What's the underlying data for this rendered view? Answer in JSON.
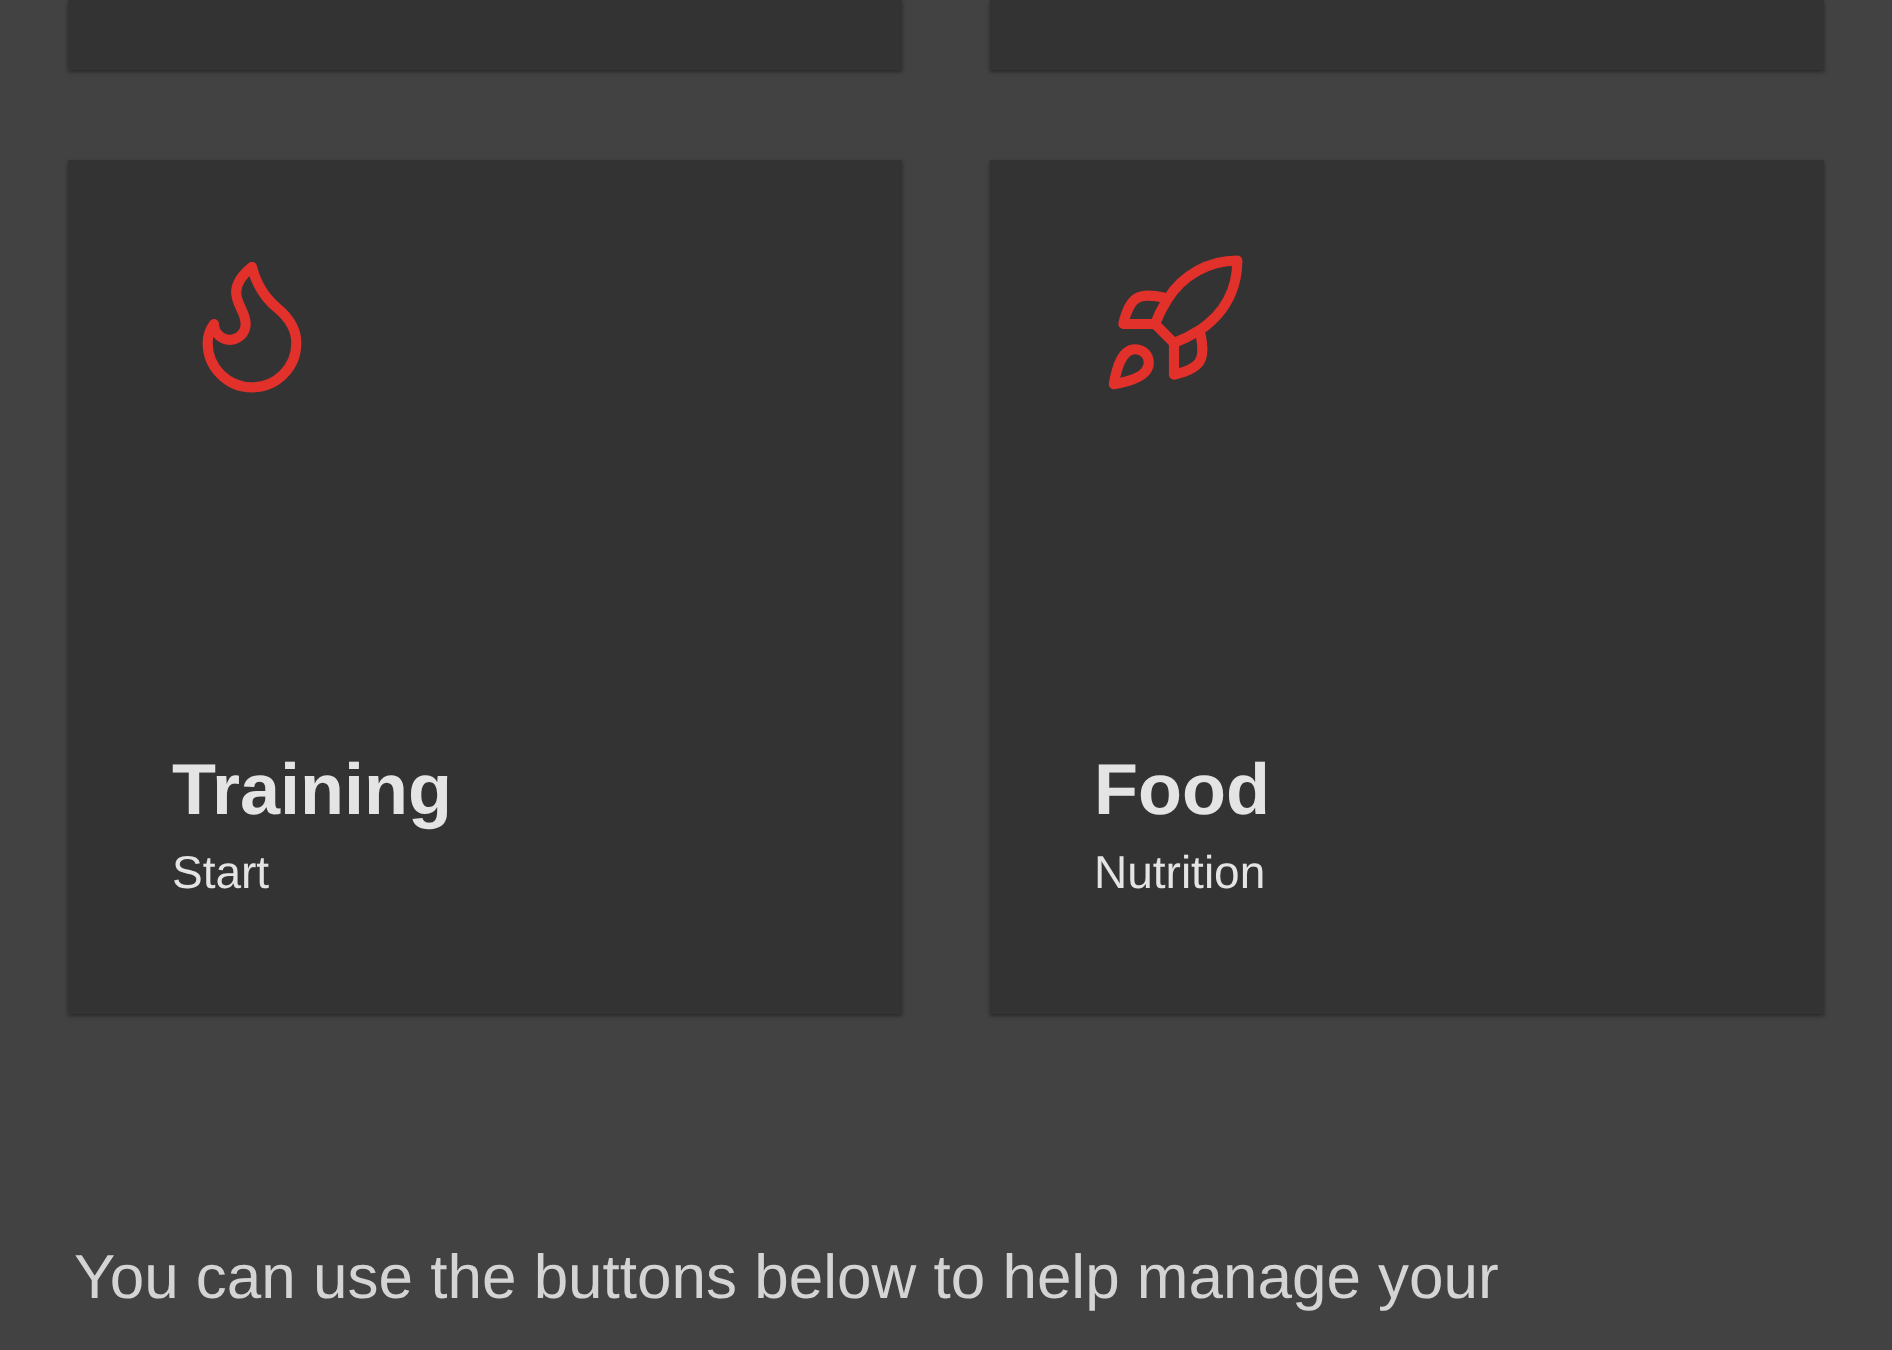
{
  "cards": [
    {
      "title": "Training",
      "subtitle": "Start",
      "kind": "flame"
    },
    {
      "title": "Food",
      "subtitle": "Nutrition",
      "kind": "rocket"
    }
  ],
  "intro": "You can use the buttons below to help manage your"
}
